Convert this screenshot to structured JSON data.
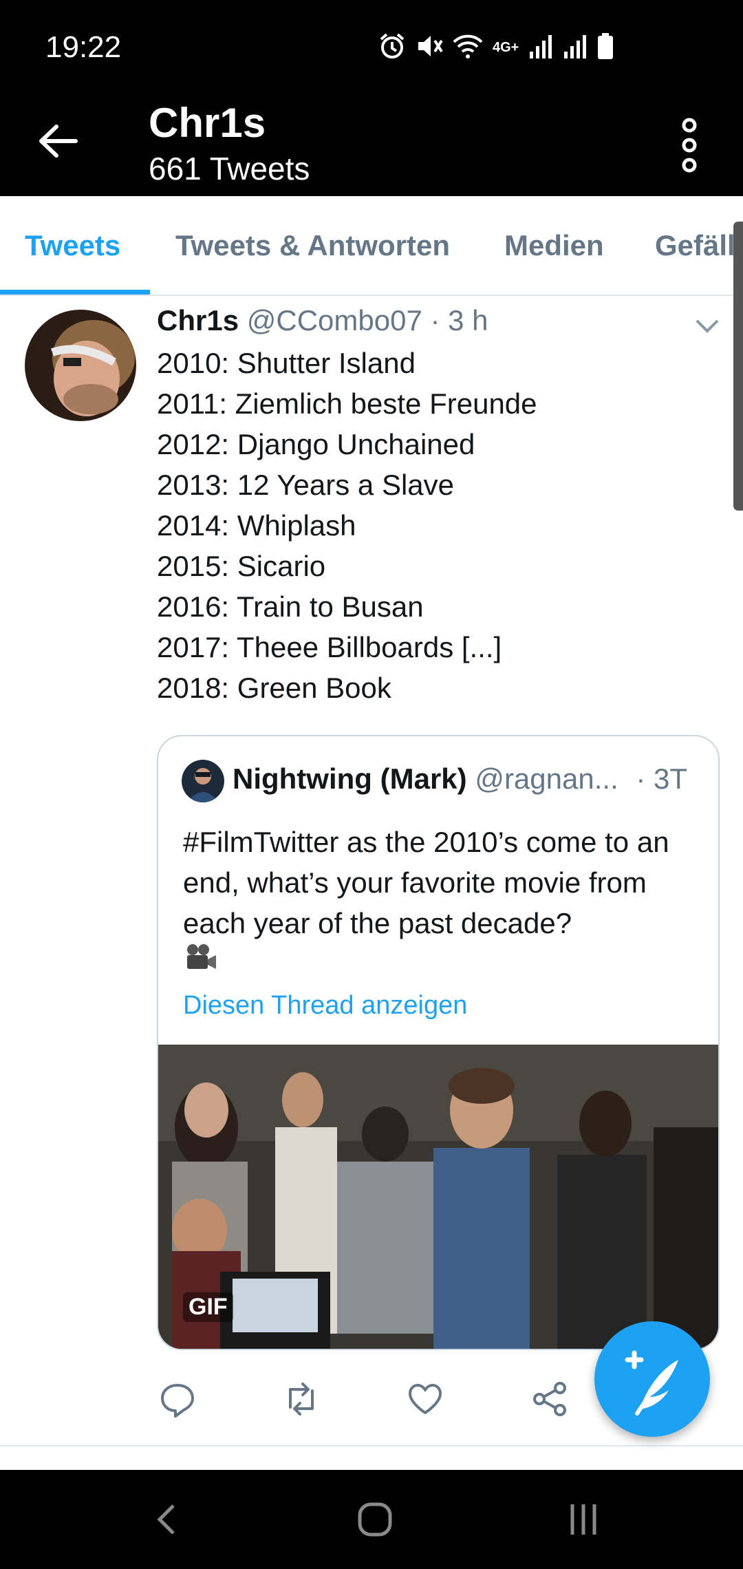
{
  "status_bar": {
    "time": "19:22",
    "network": "4G+",
    "icons": [
      "alarm-icon",
      "mute-icon",
      "wifi-icon",
      "signal-icon",
      "signal-icon",
      "battery-icon"
    ]
  },
  "app_bar": {
    "title": "Chr1s",
    "subtitle": "661 Tweets",
    "back_icon": "arrow-left-icon",
    "menu_icon": "more-vertical-icon"
  },
  "tabs": [
    {
      "label": "Tweets",
      "active": true
    },
    {
      "label": "Tweets & Antworten",
      "active": false
    },
    {
      "label": "Medien",
      "active": false
    },
    {
      "label": "Gefällt",
      "active": false
    }
  ],
  "tweet": {
    "name": "Chr1s",
    "handle": "@CCombo07",
    "time": "· 3 h",
    "lines": [
      "2010: Shutter Island",
      "2011: Ziemlich beste Freunde",
      "2012: Django Unchained",
      "2013: 12 Years a Slave",
      "2014: Whiplash",
      "2015: Sicario",
      "2016: Train to Busan",
      "2017: Theee Billboards [...]",
      "2018: Green Book"
    ],
    "quote": {
      "name": "Nightwing (Mark)",
      "handle": "@ragnan...",
      "time": "· 3T",
      "text": "#FilmTwitter as the 2010’s come to an end, what’s your favorite movie from each year of the past decade?",
      "link": "Diesen Thread anzeigen",
      "media_badge": "GIF"
    },
    "actions": [
      "reply-icon",
      "retweet-icon",
      "like-icon",
      "share-icon"
    ]
  },
  "colors": {
    "accent": "#1da1f2",
    "muted": "#657786",
    "text": "#14171a",
    "bar": "#000000"
  }
}
